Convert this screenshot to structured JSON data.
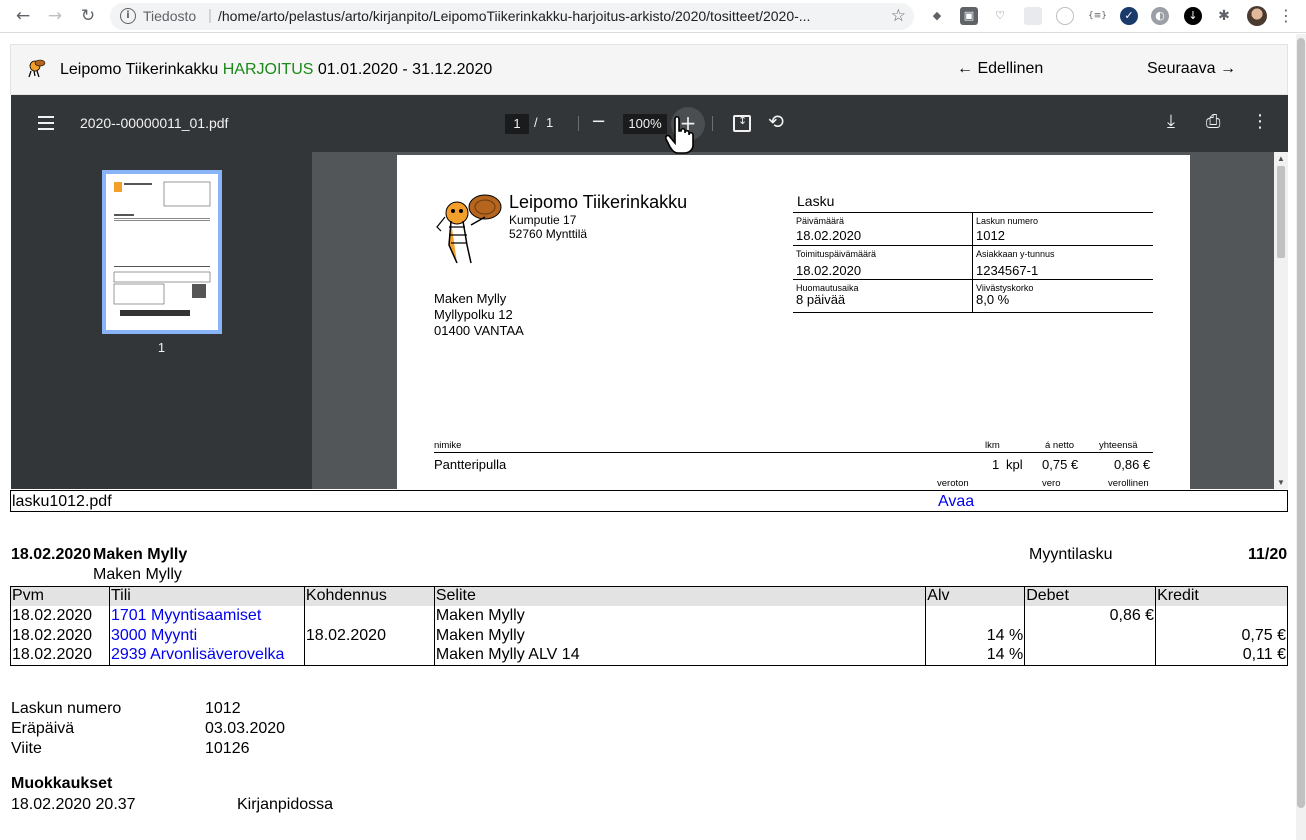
{
  "browser": {
    "scheme_label": "Tiedosto",
    "url": "/home/arto/pelastus/arto/kirjanpito/LeipomoTiikerinkakku-harjoitus-arkisto/2020/tositteet/2020-...",
    "icons": [
      "back-icon",
      "forward-icon",
      "reload-icon",
      "info-icon",
      "star-icon",
      "extensions-icon",
      "menu-icon"
    ]
  },
  "header": {
    "company": "Leipomo Tiikerinkakku",
    "mode": "HARJOITUS",
    "period": "01.01.2020 - 31.12.2020",
    "prev_label": "← Edellinen",
    "next_label": "Seuraava →",
    "mode_color": "#1a8a1a"
  },
  "pdf_viewer": {
    "file_title": "2020--00000011_01.pdf",
    "current_page": "1",
    "page_sep": "/",
    "total_pages": "1",
    "zoom": "100%",
    "thumbnail_label": "1",
    "page": {
      "company_name": "Leipomo Tiikerinkakku",
      "company_street": "Kumputie 17",
      "company_city": "52760 Mynttilä",
      "doc_title": "Lasku",
      "fields": [
        {
          "label": "Päivämäärä",
          "value": "18.02.2020"
        },
        {
          "label": "Laskun numero",
          "value": "1012"
        },
        {
          "label": "Toimituspäivämäärä",
          "value": "18.02.2020"
        },
        {
          "label": "Asiakkaan y-tunnus",
          "value": "1234567-1"
        },
        {
          "label": "Huomautusaika",
          "value": "8 päivää"
        },
        {
          "label": "Viivästyskorko",
          "value": "8,0 %"
        }
      ],
      "customer_name": "Maken Mylly",
      "customer_street": "Myllypolku 12",
      "customer_city": "01400 VANTAA",
      "columns": {
        "item": "nimike",
        "qty": "lkm",
        "unit_net": "á netto",
        "total": "yhteensä"
      },
      "row": {
        "item": "Pantteripulla",
        "qty": "1",
        "unit": "kpl",
        "unit_net": "0,75 €",
        "total": "0,86 €"
      },
      "footer_cols": {
        "net": "veroton",
        "tax": "vero",
        "gross": "verollinen"
      }
    }
  },
  "attachment": {
    "file_name": "lasku1012.pdf",
    "open_label": "Avaa"
  },
  "voucher": {
    "date": "18.02.2020",
    "party": "Maken Mylly",
    "party_sub": "Maken Mylly",
    "type": "Myyntilasku",
    "number": "11/20",
    "columns": [
      "Pvm",
      "Tili",
      "Kohdennus",
      "Selite",
      "Alv",
      "Debet",
      "Kredit"
    ],
    "rows": [
      {
        "date": "18.02.2020",
        "account": "1701 Myyntisaamiset",
        "target": "",
        "desc": "Maken Mylly",
        "vat": "",
        "debit": "0,86 €",
        "credit": ""
      },
      {
        "date": "18.02.2020",
        "account": "3000 Myynti",
        "target": "18.02.2020",
        "desc": "Maken Mylly",
        "vat": "14 %",
        "debit": "",
        "credit": "0,75 €"
      },
      {
        "date": "18.02.2020",
        "account": "2939 Arvonlisäverovelka",
        "target": "",
        "desc": "Maken Mylly ALV 14",
        "vat": "14 %",
        "debit": "",
        "credit": "0,11 €"
      }
    ]
  },
  "invoice_info": [
    {
      "label": "Laskun numero",
      "value": "1012"
    },
    {
      "label": "Eräpäivä",
      "value": "03.03.2020"
    },
    {
      "label": "Viite",
      "value": "10126"
    }
  ],
  "modifications": {
    "title": "Muokkaukset",
    "time": "18.02.2020 20.37",
    "desc": "Kirjanpidossa"
  }
}
